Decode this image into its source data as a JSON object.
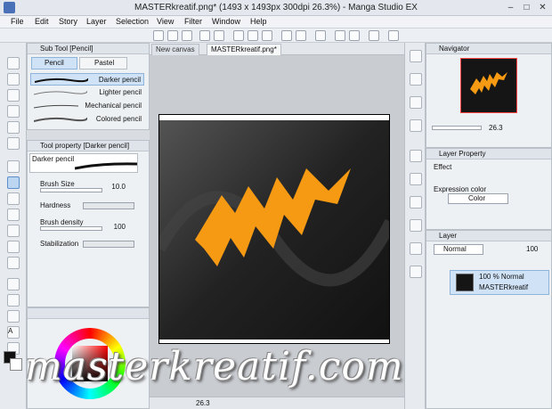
{
  "window": {
    "title": "MASTERkreatif.png* (1493 x 1493px 300dpi 26.3%)  - Manga Studio EX",
    "controls": [
      "–",
      "□",
      "✕"
    ]
  },
  "menu": [
    "File",
    "Edit",
    "Story",
    "Layer",
    "Selection",
    "View",
    "Filter",
    "Window",
    "Help"
  ],
  "sub_tool": {
    "header": "Sub Tool [Pencil]",
    "tabs": [
      "Pencil",
      "Pastel"
    ],
    "items": [
      "Darker pencil",
      "Lighter pencil",
      "Mechanical pencil",
      "Colored pencil"
    ]
  },
  "tool_property": {
    "header": "Tool property [Darker pencil]",
    "preset": "Darker pencil",
    "brush_size_label": "Brush Size",
    "brush_size_value": "10.0",
    "hardness_label": "Hardness",
    "density_label": "Brush density",
    "density_value": "100",
    "stabilization_label": "Stabilization"
  },
  "canvas": {
    "tabs": [
      "New canvas",
      "MASTERkreatif.png*"
    ],
    "zoom": "26.3",
    "status_zoom": "26.3",
    "bg_color": "#151515",
    "shape_color": "#f59a12"
  },
  "navigator": {
    "header": "Navigator",
    "zoom": "26.3"
  },
  "layer_property": {
    "header": "Layer Property",
    "effect_label": "Effect",
    "expression_label": "Expression color",
    "expression_value": "Color"
  },
  "layer": {
    "header": "Layer",
    "blend_mode": "Normal",
    "opacity": "100",
    "row_opacity": "100 %  Normal",
    "row_name": "MASTERkreatif"
  },
  "watermark": "masterkreatif.com"
}
